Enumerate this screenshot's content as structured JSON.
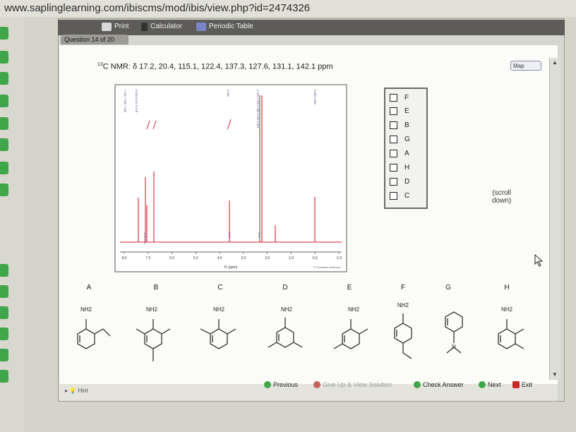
{
  "browser": {
    "url": "www.saplinglearning.com/ibiscms/mod/ibis/view.php?id=2474326"
  },
  "toolbar": {
    "print_label": "Print",
    "calculator_label": "Calculator",
    "periodic_table_label": "Periodic Table"
  },
  "question_tab": "Question 14 of 20",
  "nmr": {
    "prefix": "13",
    "text": "C NMR: δ 17.2, 20.4, 115.1, 122.4, 137.3, 127.6, 131.1, 142.1 ppm"
  },
  "map_label": "Map",
  "spectrum": {
    "axis_label": "f1 (ppm)",
    "ticks": [
      "8.0",
      "7.0",
      "6.0",
      "5.0",
      "4.0",
      "3.0",
      "2.0",
      "1.0",
      "0.0",
      "-1.0"
    ],
    "top_groups": [
      "7.320 7.300 7.285",
      "6.940 6.927 6.378",
      "3.460",
      "2.320 2.316 2.285 2.220 1.994",
      "0.880 0.880"
    ],
    "integrals": [
      "1.00 1.00",
      "2.00",
      "3.01"
    ],
    "copyright": "© Contents of Mnova"
  },
  "answers": [
    "F",
    "E",
    "B",
    "G",
    "A",
    "H",
    "D",
    "C"
  ],
  "scroll_note": [
    "(scroll",
    "down)"
  ],
  "molecules": [
    {
      "letter": "A",
      "label": "NH2"
    },
    {
      "letter": "B",
      "label": "NH2"
    },
    {
      "letter": "C",
      "label": "NH2"
    },
    {
      "letter": "D",
      "label": "NH2"
    },
    {
      "letter": "E",
      "label": "NH2"
    },
    {
      "letter": "F",
      "label": "NH2"
    },
    {
      "letter": "G",
      "label": ""
    },
    {
      "letter": "H",
      "label": "NH2"
    }
  ],
  "g_label": "N",
  "footer": {
    "hint": "Hint",
    "previous": "Previous",
    "give_up": "Give Up & View Solution",
    "check": "Check Answer",
    "next": "Next",
    "exit": "Exit"
  },
  "colors": {
    "green": "#3fa64a",
    "spectrum_red": "#d5222c",
    "toolbar": "#5d5c58"
  }
}
